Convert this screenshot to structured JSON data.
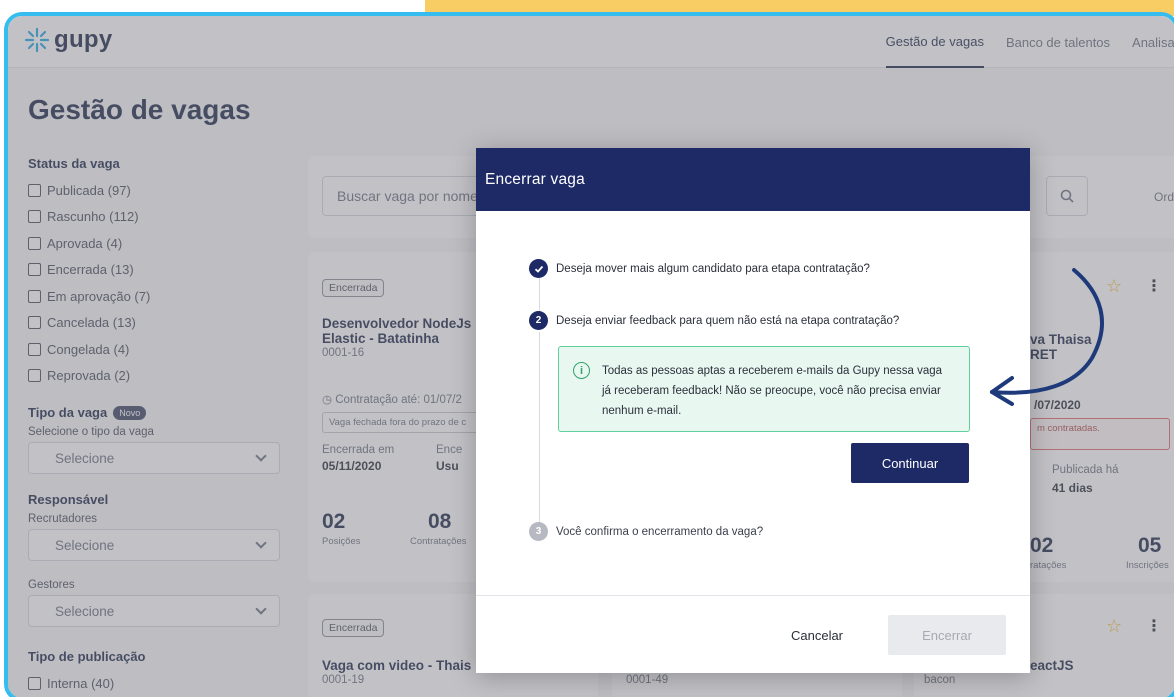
{
  "header": {
    "logo_text": "gupy",
    "nav": [
      "Gestão de vagas",
      "Banco de talentos",
      "Analisar"
    ]
  },
  "page": {
    "title": "Gestão de vagas"
  },
  "filters": {
    "status_title": "Status da vaga",
    "status_items": [
      "Publicada (97)",
      "Rascunho (112)",
      "Aprovada (4)",
      "Encerrada (13)",
      "Em aprovação (7)",
      "Cancelada (13)",
      "Congelada (4)",
      "Reprovada (2)"
    ],
    "tipo_title": "Tipo da vaga",
    "tipo_badge": "Novo",
    "tipo_sub": "Selecione o tipo da vaga",
    "tipo_select": "Selecione",
    "responsavel_title": "Responsável",
    "recrutadores_label": "Recrutadores",
    "recrutadores_select": "Selecione",
    "gestores_label": "Gestores",
    "gestores_select": "Selecione",
    "publicacao_title": "Tipo de publicação",
    "publicacao_item": "Interna (40)"
  },
  "search": {
    "placeholder": "Buscar vaga por nome",
    "order_label": "Ord"
  },
  "cards": {
    "card1": {
      "status": "Encerrada",
      "title": "Desenvolvedor NodeJs Elastic - Batatinha",
      "code": "0001-16",
      "contract": "Contratação até: 01/07/2",
      "warning": "Vaga fechada fora do prazo de c",
      "closed_label": "Encerrada em",
      "closed_date": "05/11/2020",
      "closed_by_label": "Ence",
      "closed_by": "Usu",
      "positions_num": "02",
      "positions_label": "Posições",
      "hires_num": "08",
      "hires_label": "Contratações"
    },
    "card2": {
      "title_partial": "va Thaisa",
      "subtitle_partial": "RET",
      "date_partial": "/07/2020",
      "warning": "m contratadas.",
      "published_label": "Publicada há",
      "published_value": "41 dias",
      "hires_num": "02",
      "hires_label": "ratações",
      "apps_num": "05",
      "apps_label": "Inscrições"
    },
    "card3": {
      "status": "Encerrada",
      "title": "Vaga com video - Thais",
      "code": "0001-19"
    },
    "card4": {
      "code": "0001-49"
    },
    "card5": {
      "title_partial": "eactJS",
      "code": "bacon"
    }
  },
  "modal": {
    "title": "Encerrar vaga",
    "steps": [
      {
        "number": "",
        "label": "Deseja mover mais algum candidato para etapa contratação?"
      },
      {
        "number": "2",
        "label": "Deseja enviar feedback para quem não está na etapa contratação?"
      },
      {
        "number": "3",
        "label": "Você confirma o encerramento da vaga?"
      }
    ],
    "info_text": "Todas as pessoas aptas a receberem e-mails da Gupy nessa vaga já receberam feedback! Não se preocupe, você não precisa enviar nenhum e-mail.",
    "continue_label": "Continuar",
    "cancel_label": "Cancelar",
    "close_label": "Encerrar"
  },
  "colors": {
    "primary": "#1e2a66",
    "accent_frame": "#36bdf0",
    "top_stripe": "#f8cd63",
    "success": "#2fa36b",
    "star": "#f2b230"
  }
}
